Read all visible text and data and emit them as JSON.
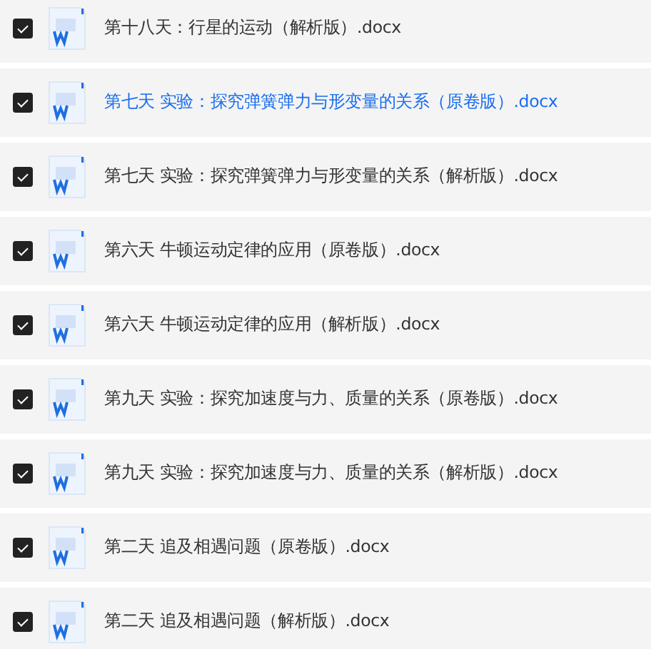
{
  "files": [
    {
      "name": "第十八天：行星的运动（解析版）.docx",
      "checked": true,
      "highlighted": false
    },
    {
      "name": "第七天 实验：探究弹簧弹力与形变量的关系（原卷版）.docx",
      "checked": true,
      "highlighted": true
    },
    {
      "name": "第七天 实验：探究弹簧弹力与形变量的关系（解析版）.docx",
      "checked": true,
      "highlighted": false
    },
    {
      "name": "第六天 牛顿运动定律的应用（原卷版）.docx",
      "checked": true,
      "highlighted": false
    },
    {
      "name": "第六天 牛顿运动定律的应用（解析版）.docx",
      "checked": true,
      "highlighted": false
    },
    {
      "name": "第九天 实验：探究加速度与力、质量的关系（原卷版）.docx",
      "checked": true,
      "highlighted": false
    },
    {
      "name": "第九天 实验：探究加速度与力、质量的关系（解析版）.docx",
      "checked": true,
      "highlighted": false
    },
    {
      "name": "第二天 追及相遇问题（原卷版）.docx",
      "checked": true,
      "highlighted": false
    },
    {
      "name": "第二天 追及相遇问题（解析版）.docx",
      "checked": true,
      "highlighted": false
    }
  ]
}
